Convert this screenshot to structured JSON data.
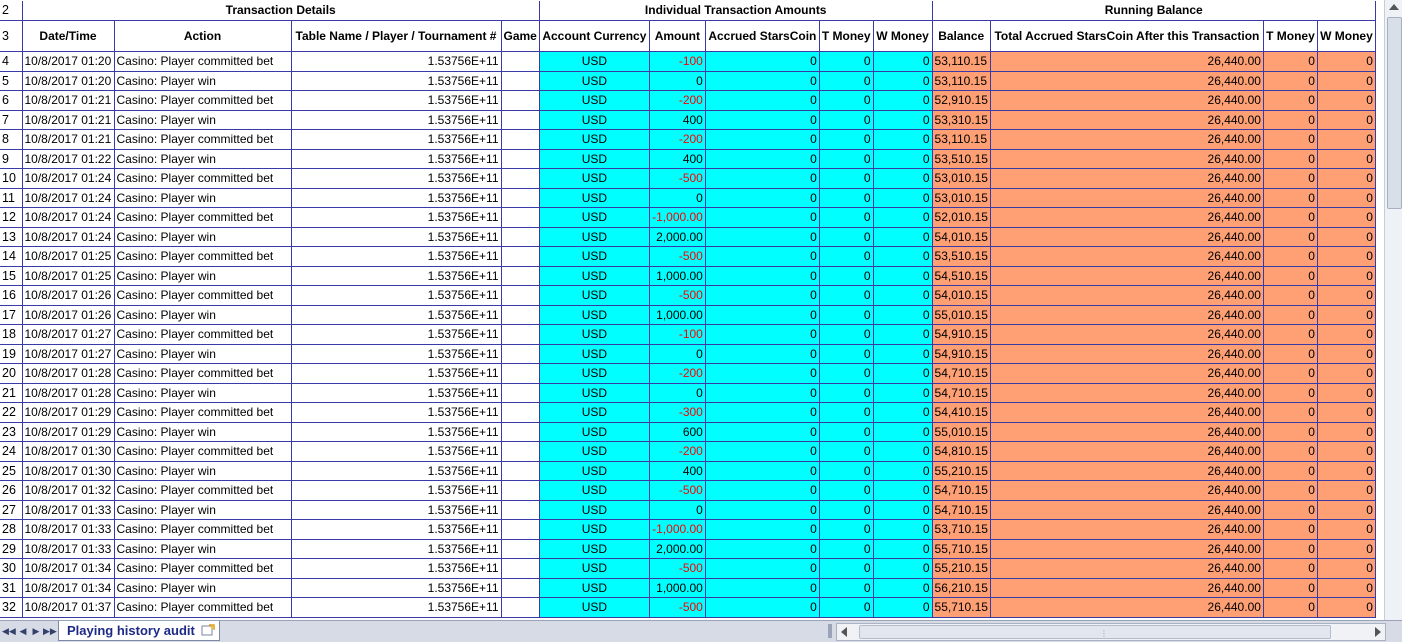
{
  "sheet": {
    "tab_name": "Playing history audit",
    "group_headers": {
      "row_number": "2",
      "transaction_details": "Transaction Details",
      "individual_amounts": "Individual Transaction Amounts",
      "running_balance": "Running Balance"
    },
    "columns": {
      "row_number": "3",
      "headers": [
        "Date/Time",
        "Action",
        "Table Name / Player / Tournament #",
        "Game",
        "Account Currency",
        "Amount",
        "Accrued StarsCoin",
        "T Money",
        "W Money",
        "Balance",
        "Total Accrued StarsCoin After this Transaction",
        "T Money",
        "W Money"
      ]
    },
    "rows": [
      {
        "n": "4",
        "date": "10/8/2017 01:20",
        "action": "Casino: Player committed bet",
        "table": "1.53756E+11",
        "game": "",
        "currency": "USD",
        "amount": "-100",
        "neg": true,
        "accrued": "0",
        "tmoney": "0",
        "wmoney": "0",
        "balance": "53,110.15",
        "total_accrued": "26,440.00",
        "t2": "0",
        "w2": "0"
      },
      {
        "n": "5",
        "date": "10/8/2017 01:20",
        "action": "Casino: Player win",
        "table": "1.53756E+11",
        "game": "",
        "currency": "USD",
        "amount": "0",
        "neg": false,
        "accrued": "0",
        "tmoney": "0",
        "wmoney": "0",
        "balance": "53,110.15",
        "total_accrued": "26,440.00",
        "t2": "0",
        "w2": "0"
      },
      {
        "n": "6",
        "date": "10/8/2017 01:21",
        "action": "Casino: Player committed bet",
        "table": "1.53756E+11",
        "game": "",
        "currency": "USD",
        "amount": "-200",
        "neg": true,
        "accrued": "0",
        "tmoney": "0",
        "wmoney": "0",
        "balance": "52,910.15",
        "total_accrued": "26,440.00",
        "t2": "0",
        "w2": "0"
      },
      {
        "n": "7",
        "date": "10/8/2017 01:21",
        "action": "Casino: Player win",
        "table": "1.53756E+11",
        "game": "",
        "currency": "USD",
        "amount": "400",
        "neg": false,
        "accrued": "0",
        "tmoney": "0",
        "wmoney": "0",
        "balance": "53,310.15",
        "total_accrued": "26,440.00",
        "t2": "0",
        "w2": "0"
      },
      {
        "n": "8",
        "date": "10/8/2017 01:21",
        "action": "Casino: Player committed bet",
        "table": "1.53756E+11",
        "game": "",
        "currency": "USD",
        "amount": "-200",
        "neg": true,
        "accrued": "0",
        "tmoney": "0",
        "wmoney": "0",
        "balance": "53,110.15",
        "total_accrued": "26,440.00",
        "t2": "0",
        "w2": "0"
      },
      {
        "n": "9",
        "date": "10/8/2017 01:22",
        "action": "Casino: Player win",
        "table": "1.53756E+11",
        "game": "",
        "currency": "USD",
        "amount": "400",
        "neg": false,
        "accrued": "0",
        "tmoney": "0",
        "wmoney": "0",
        "balance": "53,510.15",
        "total_accrued": "26,440.00",
        "t2": "0",
        "w2": "0"
      },
      {
        "n": "10",
        "date": "10/8/2017 01:24",
        "action": "Casino: Player committed bet",
        "table": "1.53756E+11",
        "game": "",
        "currency": "USD",
        "amount": "-500",
        "neg": true,
        "accrued": "0",
        "tmoney": "0",
        "wmoney": "0",
        "balance": "53,010.15",
        "total_accrued": "26,440.00",
        "t2": "0",
        "w2": "0"
      },
      {
        "n": "11",
        "date": "10/8/2017 01:24",
        "action": "Casino: Player win",
        "table": "1.53756E+11",
        "game": "",
        "currency": "USD",
        "amount": "0",
        "neg": false,
        "accrued": "0",
        "tmoney": "0",
        "wmoney": "0",
        "balance": "53,010.15",
        "total_accrued": "26,440.00",
        "t2": "0",
        "w2": "0"
      },
      {
        "n": "12",
        "date": "10/8/2017 01:24",
        "action": "Casino: Player committed bet",
        "table": "1.53756E+11",
        "game": "",
        "currency": "USD",
        "amount": "-1,000.00",
        "neg": true,
        "accrued": "0",
        "tmoney": "0",
        "wmoney": "0",
        "balance": "52,010.15",
        "total_accrued": "26,440.00",
        "t2": "0",
        "w2": "0"
      },
      {
        "n": "13",
        "date": "10/8/2017 01:24",
        "action": "Casino: Player win",
        "table": "1.53756E+11",
        "game": "",
        "currency": "USD",
        "amount": "2,000.00",
        "neg": false,
        "accrued": "0",
        "tmoney": "0",
        "wmoney": "0",
        "balance": "54,010.15",
        "total_accrued": "26,440.00",
        "t2": "0",
        "w2": "0"
      },
      {
        "n": "14",
        "date": "10/8/2017 01:25",
        "action": "Casino: Player committed bet",
        "table": "1.53756E+11",
        "game": "",
        "currency": "USD",
        "amount": "-500",
        "neg": true,
        "accrued": "0",
        "tmoney": "0",
        "wmoney": "0",
        "balance": "53,510.15",
        "total_accrued": "26,440.00",
        "t2": "0",
        "w2": "0"
      },
      {
        "n": "15",
        "date": "10/8/2017 01:25",
        "action": "Casino: Player win",
        "table": "1.53756E+11",
        "game": "",
        "currency": "USD",
        "amount": "1,000.00",
        "neg": false,
        "accrued": "0",
        "tmoney": "0",
        "wmoney": "0",
        "balance": "54,510.15",
        "total_accrued": "26,440.00",
        "t2": "0",
        "w2": "0"
      },
      {
        "n": "16",
        "date": "10/8/2017 01:26",
        "action": "Casino: Player committed bet",
        "table": "1.53756E+11",
        "game": "",
        "currency": "USD",
        "amount": "-500",
        "neg": true,
        "accrued": "0",
        "tmoney": "0",
        "wmoney": "0",
        "balance": "54,010.15",
        "total_accrued": "26,440.00",
        "t2": "0",
        "w2": "0"
      },
      {
        "n": "17",
        "date": "10/8/2017 01:26",
        "action": "Casino: Player win",
        "table": "1.53756E+11",
        "game": "",
        "currency": "USD",
        "amount": "1,000.00",
        "neg": false,
        "accrued": "0",
        "tmoney": "0",
        "wmoney": "0",
        "balance": "55,010.15",
        "total_accrued": "26,440.00",
        "t2": "0",
        "w2": "0"
      },
      {
        "n": "18",
        "date": "10/8/2017 01:27",
        "action": "Casino: Player committed bet",
        "table": "1.53756E+11",
        "game": "",
        "currency": "USD",
        "amount": "-100",
        "neg": true,
        "accrued": "0",
        "tmoney": "0",
        "wmoney": "0",
        "balance": "54,910.15",
        "total_accrued": "26,440.00",
        "t2": "0",
        "w2": "0"
      },
      {
        "n": "19",
        "date": "10/8/2017 01:27",
        "action": "Casino: Player win",
        "table": "1.53756E+11",
        "game": "",
        "currency": "USD",
        "amount": "0",
        "neg": false,
        "accrued": "0",
        "tmoney": "0",
        "wmoney": "0",
        "balance": "54,910.15",
        "total_accrued": "26,440.00",
        "t2": "0",
        "w2": "0"
      },
      {
        "n": "20",
        "date": "10/8/2017 01:28",
        "action": "Casino: Player committed bet",
        "table": "1.53756E+11",
        "game": "",
        "currency": "USD",
        "amount": "-200",
        "neg": true,
        "accrued": "0",
        "tmoney": "0",
        "wmoney": "0",
        "balance": "54,710.15",
        "total_accrued": "26,440.00",
        "t2": "0",
        "w2": "0"
      },
      {
        "n": "21",
        "date": "10/8/2017 01:28",
        "action": "Casino: Player win",
        "table": "1.53756E+11",
        "game": "",
        "currency": "USD",
        "amount": "0",
        "neg": false,
        "accrued": "0",
        "tmoney": "0",
        "wmoney": "0",
        "balance": "54,710.15",
        "total_accrued": "26,440.00",
        "t2": "0",
        "w2": "0"
      },
      {
        "n": "22",
        "date": "10/8/2017 01:29",
        "action": "Casino: Player committed bet",
        "table": "1.53756E+11",
        "game": "",
        "currency": "USD",
        "amount": "-300",
        "neg": true,
        "accrued": "0",
        "tmoney": "0",
        "wmoney": "0",
        "balance": "54,410.15",
        "total_accrued": "26,440.00",
        "t2": "0",
        "w2": "0"
      },
      {
        "n": "23",
        "date": "10/8/2017 01:29",
        "action": "Casino: Player win",
        "table": "1.53756E+11",
        "game": "",
        "currency": "USD",
        "amount": "600",
        "neg": false,
        "accrued": "0",
        "tmoney": "0",
        "wmoney": "0",
        "balance": "55,010.15",
        "total_accrued": "26,440.00",
        "t2": "0",
        "w2": "0"
      },
      {
        "n": "24",
        "date": "10/8/2017 01:30",
        "action": "Casino: Player committed bet",
        "table": "1.53756E+11",
        "game": "",
        "currency": "USD",
        "amount": "-200",
        "neg": true,
        "accrued": "0",
        "tmoney": "0",
        "wmoney": "0",
        "balance": "54,810.15",
        "total_accrued": "26,440.00",
        "t2": "0",
        "w2": "0"
      },
      {
        "n": "25",
        "date": "10/8/2017 01:30",
        "action": "Casino: Player win",
        "table": "1.53756E+11",
        "game": "",
        "currency": "USD",
        "amount": "400",
        "neg": false,
        "accrued": "0",
        "tmoney": "0",
        "wmoney": "0",
        "balance": "55,210.15",
        "total_accrued": "26,440.00",
        "t2": "0",
        "w2": "0"
      },
      {
        "n": "26",
        "date": "10/8/2017 01:32",
        "action": "Casino: Player committed bet",
        "table": "1.53756E+11",
        "game": "",
        "currency": "USD",
        "amount": "-500",
        "neg": true,
        "accrued": "0",
        "tmoney": "0",
        "wmoney": "0",
        "balance": "54,710.15",
        "total_accrued": "26,440.00",
        "t2": "0",
        "w2": "0"
      },
      {
        "n": "27",
        "date": "10/8/2017 01:33",
        "action": "Casino: Player win",
        "table": "1.53756E+11",
        "game": "",
        "currency": "USD",
        "amount": "0",
        "neg": false,
        "accrued": "0",
        "tmoney": "0",
        "wmoney": "0",
        "balance": "54,710.15",
        "total_accrued": "26,440.00",
        "t2": "0",
        "w2": "0"
      },
      {
        "n": "28",
        "date": "10/8/2017 01:33",
        "action": "Casino: Player committed bet",
        "table": "1.53756E+11",
        "game": "",
        "currency": "USD",
        "amount": "-1,000.00",
        "neg": true,
        "accrued": "0",
        "tmoney": "0",
        "wmoney": "0",
        "balance": "53,710.15",
        "total_accrued": "26,440.00",
        "t2": "0",
        "w2": "0"
      },
      {
        "n": "29",
        "date": "10/8/2017 01:33",
        "action": "Casino: Player win",
        "table": "1.53756E+11",
        "game": "",
        "currency": "USD",
        "amount": "2,000.00",
        "neg": false,
        "accrued": "0",
        "tmoney": "0",
        "wmoney": "0",
        "balance": "55,710.15",
        "total_accrued": "26,440.00",
        "t2": "0",
        "w2": "0"
      },
      {
        "n": "30",
        "date": "10/8/2017 01:34",
        "action": "Casino: Player committed bet",
        "table": "1.53756E+11",
        "game": "",
        "currency": "USD",
        "amount": "-500",
        "neg": true,
        "accrued": "0",
        "tmoney": "0",
        "wmoney": "0",
        "balance": "55,210.15",
        "total_accrued": "26,440.00",
        "t2": "0",
        "w2": "0"
      },
      {
        "n": "31",
        "date": "10/8/2017 01:34",
        "action": "Casino: Player win",
        "table": "1.53756E+11",
        "game": "",
        "currency": "USD",
        "amount": "1,000.00",
        "neg": false,
        "accrued": "0",
        "tmoney": "0",
        "wmoney": "0",
        "balance": "56,210.15",
        "total_accrued": "26,440.00",
        "t2": "0",
        "w2": "0"
      },
      {
        "n": "32",
        "date": "10/8/2017 01:37",
        "action": "Casino: Player committed bet",
        "table": "1.53756E+11",
        "game": "",
        "currency": "USD",
        "amount": "-500",
        "neg": true,
        "accrued": "0",
        "tmoney": "0",
        "wmoney": "0",
        "balance": "55,710.15",
        "total_accrued": "26,440.00",
        "t2": "0",
        "w2": "0"
      }
    ]
  },
  "colors": {
    "amounts_fill": "#00ffff",
    "running_balance_fill": "#ff9f74",
    "negative_text": "#ff0000",
    "grid_line": "#3a3aa6"
  },
  "icons": {
    "nav_first": "first-sheet-icon",
    "nav_prev": "prev-sheet-icon",
    "nav_next": "next-sheet-icon",
    "nav_last": "last-sheet-icon",
    "new_sheet": "insert-sheet-icon"
  }
}
